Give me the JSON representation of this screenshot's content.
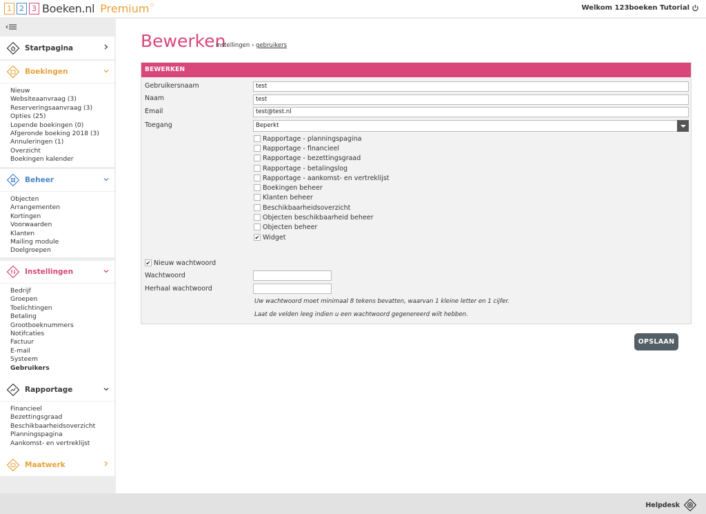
{
  "header": {
    "logo_digits": [
      "1",
      "2",
      "3"
    ],
    "brand": "Boeken.nl",
    "edition": "Premium",
    "edition_star": "☆",
    "welcome": "Welkom 123boeken Tutorial"
  },
  "sidebar": {
    "sections": [
      {
        "title": "Startpagina",
        "items": []
      },
      {
        "title": "Boekingen",
        "items": [
          "Nieuw",
          "Websiteaanvraag (3)",
          "Reserveringsaanvraag (3)",
          "Opties (25)",
          "Lopende boekingen (0)",
          "Afgeronde boeking 2018 (3)",
          "Annuleringen (1)",
          "Overzicht",
          "Boekingen kalender"
        ]
      },
      {
        "title": "Beheer",
        "items": [
          "Objecten",
          "Arrangementen",
          "Kortingen",
          "Voorwaarden",
          "Klanten",
          "Mailing module",
          "Doelgroepen"
        ]
      },
      {
        "title": "Instellingen",
        "items": [
          "Bedrijf",
          "Groepen",
          "Toelichtingen",
          "Betaling",
          "Grootboeknummers",
          "Notifcaties",
          "Factuur",
          "E-mail",
          "Systeem",
          "Gebruikers"
        ]
      },
      {
        "title": "Rapportage",
        "items": [
          "Financieel",
          "Bezettingsgraad",
          "Beschikbaarheidsoverzicht",
          "Planningspagina",
          "Aankomst- en vertreklijst"
        ]
      },
      {
        "title": "Maatwerk",
        "items": []
      }
    ]
  },
  "main": {
    "title": "Bewerken",
    "breadcrumb": {
      "parent": "instellingen",
      "separator": "›",
      "current": "gebruikers"
    },
    "panel_title": "BEWERKEN",
    "fields": {
      "username_label": "Gebruikersnaam",
      "username_value": "test",
      "name_label": "Naam",
      "name_value": "test",
      "email_label": "Email",
      "email_value": "test@test.nl",
      "access_label": "Toegang",
      "access_value": "Beperkt"
    },
    "permissions": [
      {
        "label": "Rapportage - planningspagina",
        "checked": false
      },
      {
        "label": "Rapportage - financieel",
        "checked": false
      },
      {
        "label": "Rapportage - bezettingsgraad",
        "checked": false
      },
      {
        "label": "Rapportage - betalingslog",
        "checked": false
      },
      {
        "label": "Rapportage - aankomst- en vertreklijst",
        "checked": false
      },
      {
        "label": "Boekingen beheer",
        "checked": false
      },
      {
        "label": "Klanten beheer",
        "checked": false
      },
      {
        "label": "Beschikbaarheidsoverzicht",
        "checked": false
      },
      {
        "label": "Objecten beschikbaarheid beheer",
        "checked": false
      },
      {
        "label": "Objecten beheer",
        "checked": false
      },
      {
        "label": "Widget",
        "checked": true
      }
    ],
    "new_password_label": "Nieuw wachtwoord",
    "new_password_checked": true,
    "password_label": "Wachtwoord",
    "repeat_password_label": "Herhaal wachtwoord",
    "hint_1": "Uw wachtwoord moet minimaal 8 tekens bevatten, waarvan 1 kleine letter en 1 cijfer.",
    "hint_2": "Laat de velden leeg indien u een wachtwoord gegenereerd wilt hebben.",
    "save_label": "OPSLAAN",
    "check_mark": "✔"
  },
  "footer": {
    "helpdesk": "Helpdesk"
  },
  "colors": {
    "pink": "#d8467a",
    "orange": "#e8a23a",
    "blue": "#4a86c8",
    "button": "#545e67"
  }
}
